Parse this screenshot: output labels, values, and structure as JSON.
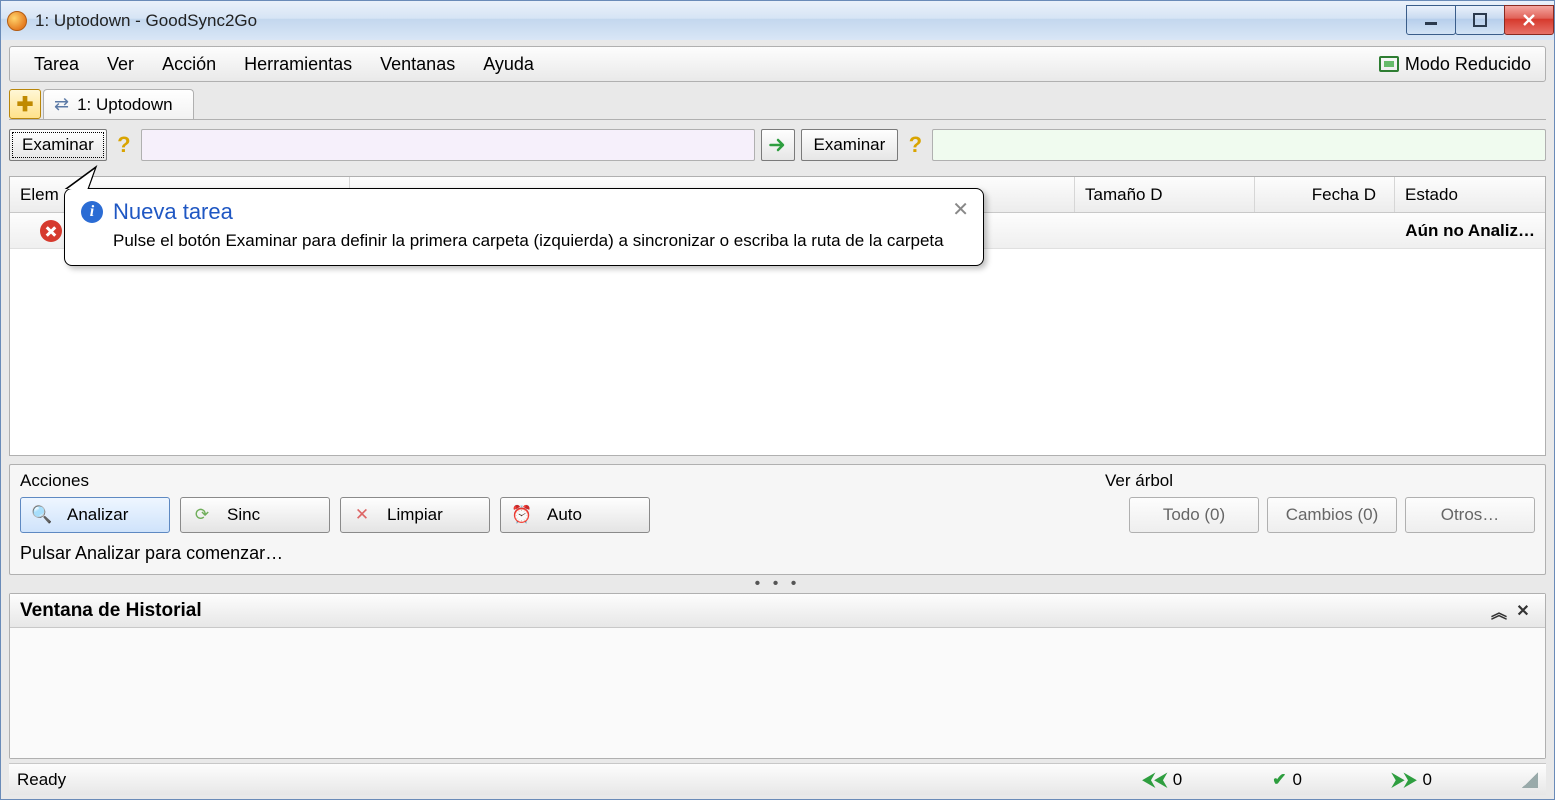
{
  "window": {
    "title": "1: Uptodown - GoodSync2Go"
  },
  "menu": {
    "items": [
      "Tarea",
      "Ver",
      "Acción",
      "Herramientas",
      "Ventanas",
      "Ayuda"
    ],
    "reduced_mode": "Modo Reducido"
  },
  "tabs": {
    "current": "1: Uptodown"
  },
  "paths": {
    "examine_left": "Examinar",
    "examine_right": "Examinar",
    "left_value": "",
    "right_value": ""
  },
  "grid": {
    "headers": {
      "elem": "Elem",
      "size_d": "Tamaño D",
      "date_d": "Fecha D",
      "state": "Estado"
    },
    "row_status": "Aún no Analiz…"
  },
  "callout": {
    "title": "Nueva tarea",
    "body": "Pulse el botón Examinar para definir la primera carpeta (izquierda) a sincronizar o escriba la ruta de la carpeta"
  },
  "actions": {
    "section_label": "Acciones",
    "analyze": "Analizar",
    "sync": "Sinc",
    "clean": "Limpiar",
    "auto": "Auto",
    "tree_label": "Ver árbol",
    "tree_all": "Todo (0)",
    "tree_changes": "Cambios (0)",
    "tree_others": "Otros…",
    "hint": "Pulsar Analizar para comenzar…"
  },
  "history": {
    "title": "Ventana de Historial"
  },
  "status": {
    "ready": "Ready",
    "left_count": "0",
    "ok_count": "0",
    "right_count": "0"
  }
}
